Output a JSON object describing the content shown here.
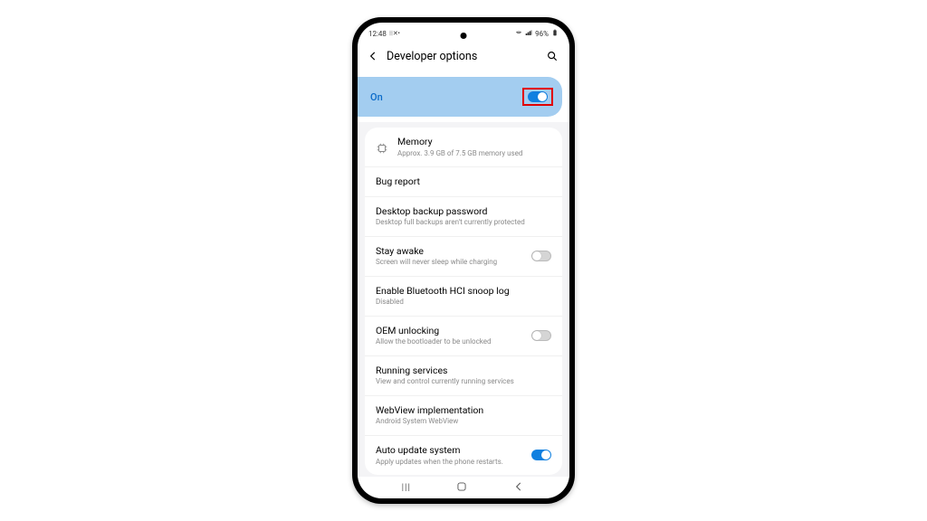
{
  "status": {
    "time": "12:48",
    "indicators_left": "⁝ ⁝ ✕ •",
    "wifi_icon": "wifi",
    "signal_icon": "signal",
    "battery_text": "96%",
    "battery_icon": "battery"
  },
  "header": {
    "title": "Developer options"
  },
  "master": {
    "label": "On",
    "state": "on"
  },
  "items": [
    {
      "title": "Memory",
      "subtitle": "Approx. 3.9 GB of 7.5 GB memory used",
      "icon": "memory",
      "toggle": null
    },
    {
      "title": "Bug report",
      "subtitle": "",
      "icon": null,
      "toggle": null
    },
    {
      "title": "Desktop backup password",
      "subtitle": "Desktop full backups aren't currently protected",
      "icon": null,
      "toggle": null
    },
    {
      "title": "Stay awake",
      "subtitle": "Screen will never sleep while charging",
      "icon": null,
      "toggle": "off"
    },
    {
      "title": "Enable Bluetooth HCI snoop log",
      "subtitle": "Disabled",
      "icon": null,
      "toggle": null
    },
    {
      "title": "OEM unlocking",
      "subtitle": "Allow the bootloader to be unlocked",
      "icon": null,
      "toggle": "off"
    },
    {
      "title": "Running services",
      "subtitle": "View and control currently running services",
      "icon": null,
      "toggle": null
    },
    {
      "title": "WebView implementation",
      "subtitle": "Android System WebView",
      "icon": null,
      "toggle": null
    },
    {
      "title": "Auto update system",
      "subtitle": "Apply updates when the phone restarts.",
      "icon": null,
      "toggle": "on"
    }
  ]
}
